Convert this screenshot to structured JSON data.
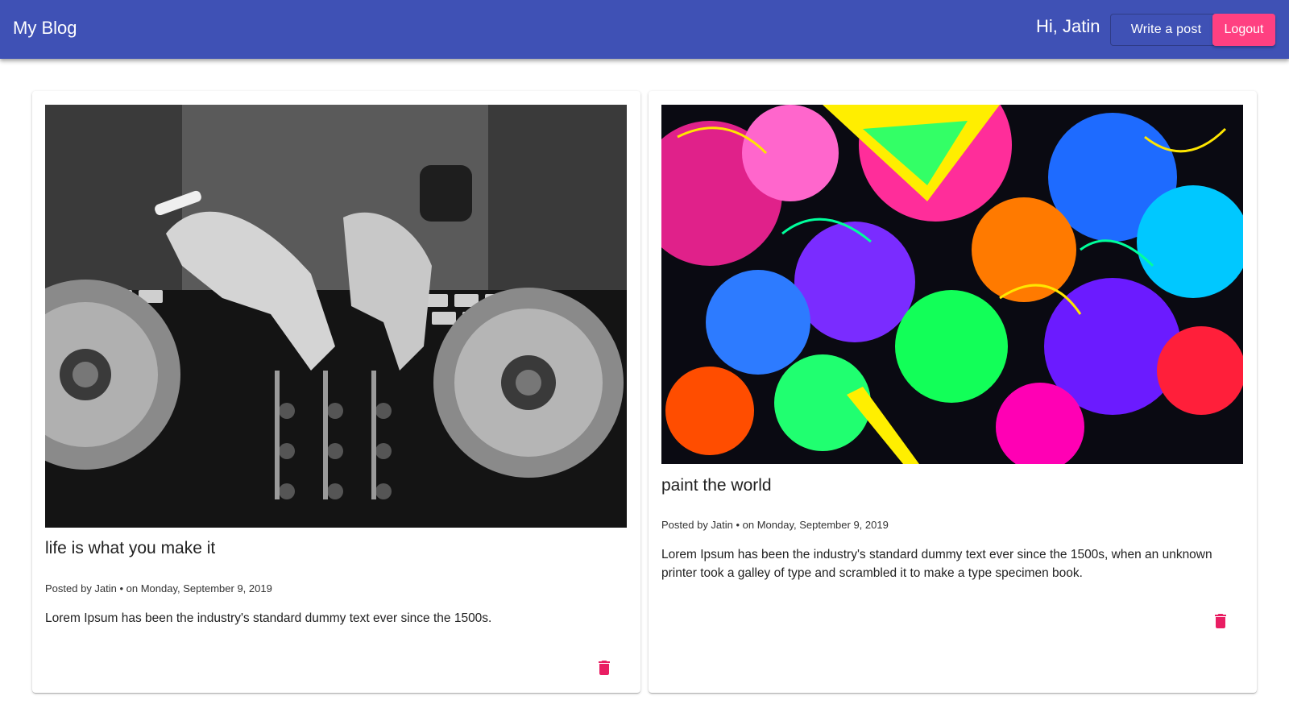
{
  "header": {
    "brand": "My Blog",
    "greeting": "Hi, Jatin",
    "write_label": "Write a post",
    "logout_label": "Logout",
    "primary_color": "#3f51b5",
    "accent_color": "#ff4081"
  },
  "posts": [
    {
      "title": "life is what you make it",
      "meta": "Posted by Jatin • on Monday, September 9, 2019",
      "body": "Lorem Ipsum has been the industry's standard dummy text ever since the 1500s.",
      "image": "dj-mixer-photo",
      "delete_icon": "trash-icon"
    },
    {
      "title": "paint the world",
      "meta": "Posted by Jatin • on Monday, September 9, 2019",
      "body": "Lorem Ipsum has been the industry's standard dummy text ever since the 1500s, when an unknown printer took a galley of type and scrambled it to make a type specimen book.",
      "image": "psychedelic-art",
      "delete_icon": "trash-icon"
    }
  ],
  "delete_color": "#e91e63"
}
